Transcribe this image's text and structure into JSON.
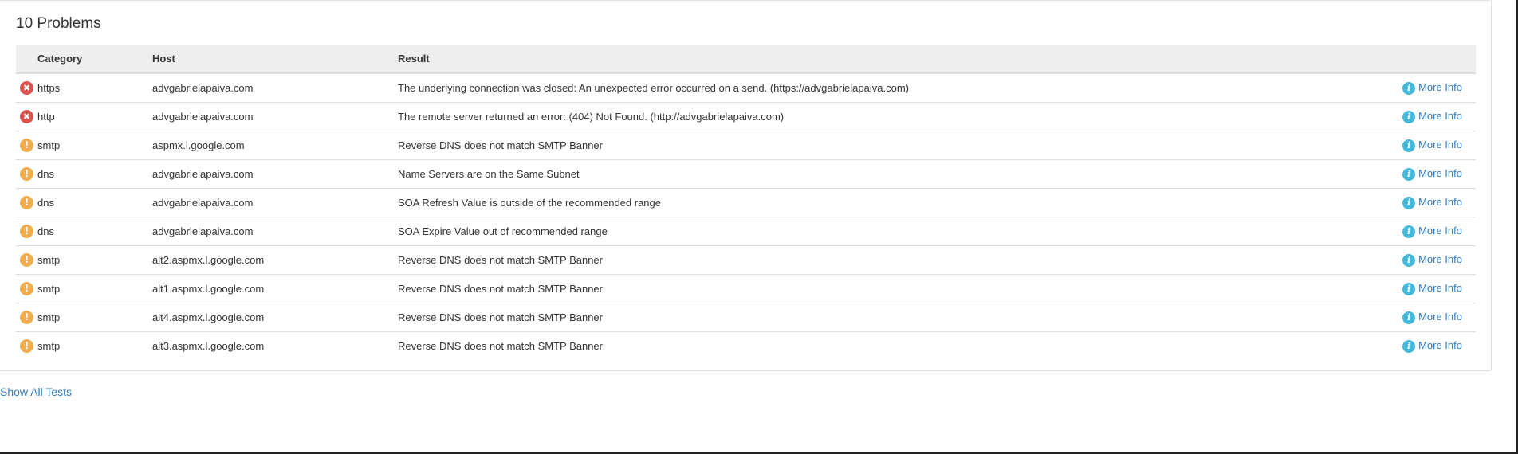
{
  "panel": {
    "title": "10 Problems"
  },
  "table": {
    "headers": {
      "category": "Category",
      "host": "Host",
      "result": "Result"
    },
    "rows": [
      {
        "status": "error",
        "status_icon": "error-circle-icon",
        "category": "https",
        "host": "advgabrielapaiva.com",
        "result": "The underlying connection was closed: An unexpected error occurred on a send. (https://advgabrielapaiva.com)",
        "action": "More Info"
      },
      {
        "status": "error",
        "status_icon": "error-circle-icon",
        "category": "http",
        "host": "advgabrielapaiva.com",
        "result": "The remote server returned an error: (404) Not Found. (http://advgabrielapaiva.com)",
        "action": "More Info"
      },
      {
        "status": "warning",
        "status_icon": "warning-circle-icon",
        "category": "smtp",
        "host": "aspmx.l.google.com",
        "result": "Reverse DNS does not match SMTP Banner",
        "action": "More Info"
      },
      {
        "status": "warning",
        "status_icon": "warning-circle-icon",
        "category": "dns",
        "host": "advgabrielapaiva.com",
        "result": "Name Servers are on the Same Subnet",
        "action": "More Info"
      },
      {
        "status": "warning",
        "status_icon": "warning-circle-icon",
        "category": "dns",
        "host": "advgabrielapaiva.com",
        "result": "SOA Refresh Value is outside of the recommended range",
        "action": "More Info"
      },
      {
        "status": "warning",
        "status_icon": "warning-circle-icon",
        "category": "dns",
        "host": "advgabrielapaiva.com",
        "result": "SOA Expire Value out of recommended range",
        "action": "More Info"
      },
      {
        "status": "warning",
        "status_icon": "warning-circle-icon",
        "category": "smtp",
        "host": "alt2.aspmx.l.google.com",
        "result": "Reverse DNS does not match SMTP Banner",
        "action": "More Info"
      },
      {
        "status": "warning",
        "status_icon": "warning-circle-icon",
        "category": "smtp",
        "host": "alt1.aspmx.l.google.com",
        "result": "Reverse DNS does not match SMTP Banner",
        "action": "More Info"
      },
      {
        "status": "warning",
        "status_icon": "warning-circle-icon",
        "category": "smtp",
        "host": "alt4.aspmx.l.google.com",
        "result": "Reverse DNS does not match SMTP Banner",
        "action": "More Info"
      },
      {
        "status": "warning",
        "status_icon": "warning-circle-icon",
        "category": "smtp",
        "host": "alt3.aspmx.l.google.com",
        "result": "Reverse DNS does not match SMTP Banner",
        "action": "More Info"
      }
    ]
  },
  "footer": {
    "show_all_label": "Show All Tests"
  },
  "colors": {
    "error": "#d9534f",
    "warning": "#f0ad4e",
    "info": "#46b8da",
    "link": "#337ab7",
    "header_bg": "#eeeeee",
    "border": "#dddddd"
  }
}
